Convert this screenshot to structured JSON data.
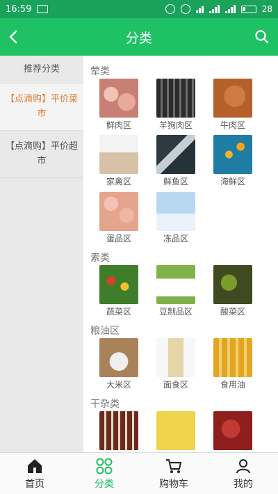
{
  "status_bar": {
    "time": "16:59",
    "battery": "28"
  },
  "header": {
    "title": "分类",
    "back_icon": "back-chevron-icon",
    "search_icon": "search-icon"
  },
  "sidebar": {
    "items": [
      {
        "label": "推荐分类"
      },
      {
        "label": "【点滴购】平价菜市"
      },
      {
        "label": "【点滴购】平价超市"
      }
    ]
  },
  "sections": [
    {
      "title": "荤类",
      "items": [
        {
          "label": "鲜肉区",
          "img": "img-fresh-meat"
        },
        {
          "label": "羊狗肉区",
          "img": "img-lamb"
        },
        {
          "label": "牛肉区",
          "img": "img-beef"
        },
        {
          "label": "家禽区",
          "img": "img-poultry"
        },
        {
          "label": "鲜鱼区",
          "img": "img-fish"
        },
        {
          "label": "海鲜区",
          "img": "img-seafood"
        },
        {
          "label": "蛋品区",
          "img": "img-eggs"
        },
        {
          "label": "冻品区",
          "img": "img-frozen"
        }
      ]
    },
    {
      "title": "素类",
      "items": [
        {
          "label": "蔬菜区",
          "img": "img-veg"
        },
        {
          "label": "豆制品区",
          "img": "img-tofu"
        },
        {
          "label": "酸菜区",
          "img": "img-pickles"
        }
      ]
    },
    {
      "title": "粮油区",
      "items": [
        {
          "label": "大米区",
          "img": "img-rice"
        },
        {
          "label": "面食区",
          "img": "img-noodle"
        },
        {
          "label": "食用油",
          "img": "img-oil"
        }
      ]
    },
    {
      "title": "干杂类",
      "items": [
        {
          "label": "",
          "img": "img-sauce"
        },
        {
          "label": "",
          "img": "img-nanbei"
        },
        {
          "label": "",
          "img": "img-meatbox"
        }
      ]
    }
  ],
  "bottom_nav": {
    "items": [
      {
        "label": "首页",
        "icon": "home-icon"
      },
      {
        "label": "分类",
        "icon": "category-icon"
      },
      {
        "label": "购物车",
        "icon": "cart-icon"
      },
      {
        "label": "我的",
        "icon": "user-icon"
      }
    ]
  },
  "colors": {
    "header": "#1ec164",
    "status_bar": "#1aa25a",
    "accent_orange": "#e07a2a"
  }
}
